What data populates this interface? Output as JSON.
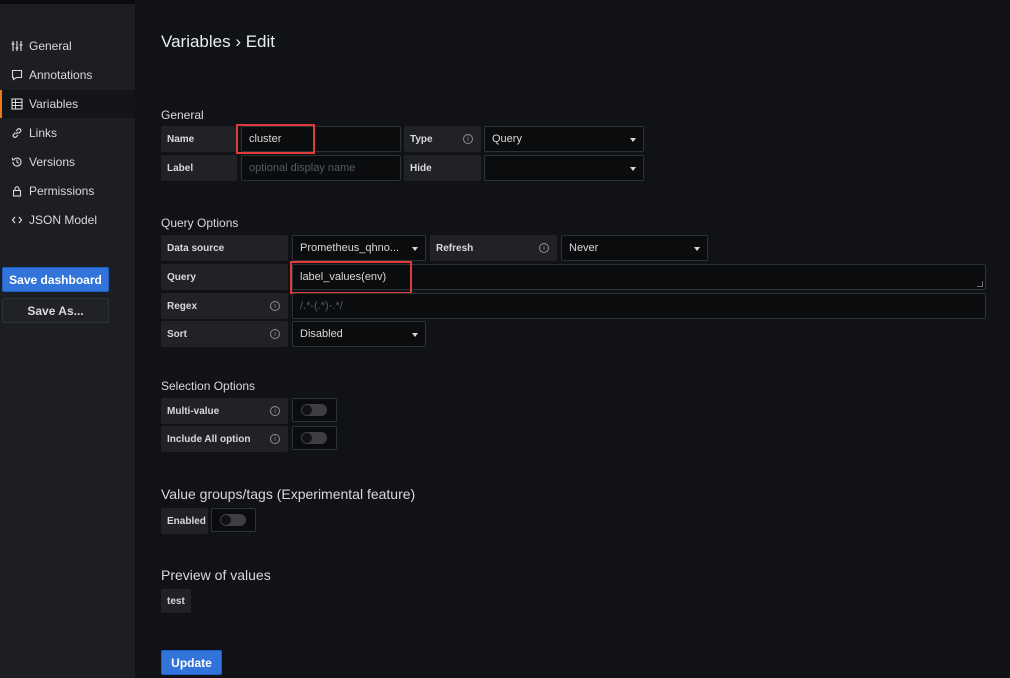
{
  "sidebar": {
    "items": [
      {
        "label": "General",
        "icon": "sliders-icon"
      },
      {
        "label": "Annotations",
        "icon": "comment-icon"
      },
      {
        "label": "Variables",
        "icon": "table-icon"
      },
      {
        "label": "Links",
        "icon": "link-icon"
      },
      {
        "label": "Versions",
        "icon": "history-icon"
      },
      {
        "label": "Permissions",
        "icon": "lock-icon"
      },
      {
        "label": "JSON Model",
        "icon": "code-icon"
      }
    ],
    "active": "Variables",
    "save_dashboard_label": "Save dashboard",
    "save_as_label": "Save As..."
  },
  "page": {
    "title": "Variables › Edit"
  },
  "general": {
    "section_title": "General",
    "name_label": "Name",
    "name_value": "cluster",
    "type_label": "Type",
    "type_value": "Query",
    "label_label": "Label",
    "label_placeholder": "optional display name",
    "hide_label": "Hide",
    "hide_value": ""
  },
  "query_options": {
    "section_title": "Query Options",
    "datasource_label": "Data source",
    "datasource_value": "Prometheus_qhno...",
    "refresh_label": "Refresh",
    "refresh_value": "Never",
    "query_label": "Query",
    "query_value": "label_values(env)",
    "regex_label": "Regex",
    "regex_placeholder": "/.*-(.*)-.*/",
    "sort_label": "Sort",
    "sort_value": "Disabled"
  },
  "selection_options": {
    "section_title": "Selection Options",
    "multi_value_label": "Multi-value",
    "multi_value_enabled": false,
    "include_all_label": "Include All option",
    "include_all_enabled": false
  },
  "value_groups": {
    "section_title": "Value groups/tags (Experimental feature)",
    "enabled_label": "Enabled",
    "enabled": false
  },
  "preview": {
    "section_title": "Preview of values",
    "values": [
      "test"
    ]
  },
  "update_label": "Update",
  "colors": {
    "primary": "#3274d9",
    "highlight": "#e03a3a",
    "active_accent": "#eb7b18"
  }
}
